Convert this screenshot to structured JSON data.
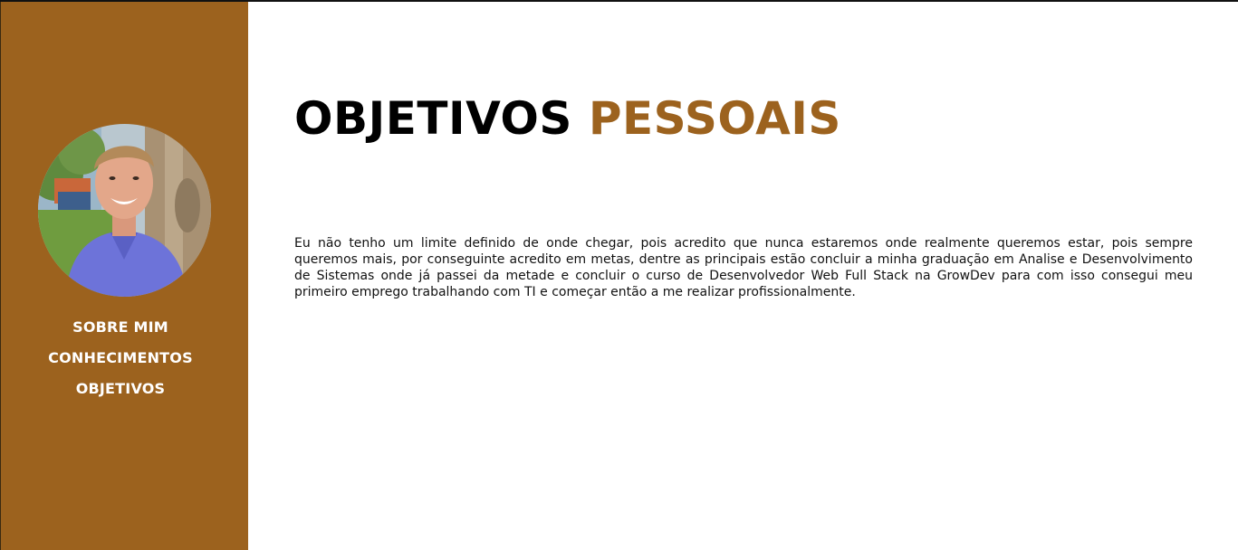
{
  "colors": {
    "sidebar_bg": "#9c621e",
    "accent": "#9c621e",
    "nav_text": "#ffffff",
    "title_primary": "#000000",
    "body_text": "#111111"
  },
  "sidebar": {
    "avatar_icon": "profile-photo",
    "nav": [
      {
        "label": "SOBRE MIM"
      },
      {
        "label": "CONHECIMENTOS"
      },
      {
        "label": "OBJETIVOS"
      }
    ]
  },
  "main": {
    "title_word_1": "OBJETIVOS",
    "title_word_2": "PESSOAIS",
    "paragraph": "Eu não tenho um limite definido de onde chegar, pois acredito que nunca estaremos onde realmente queremos estar, pois sempre queremos mais, por conseguinte acredito em metas, dentre as principais estão concluir a minha graduação em Analise e Desenvolvimento de Sistemas onde já passei da metade e concluir o curso de Desenvolvedor Web Full Stack na GrowDev para com isso consegui meu primeiro emprego trabalhando com TI e começar então a me realizar profissionalmente."
  }
}
